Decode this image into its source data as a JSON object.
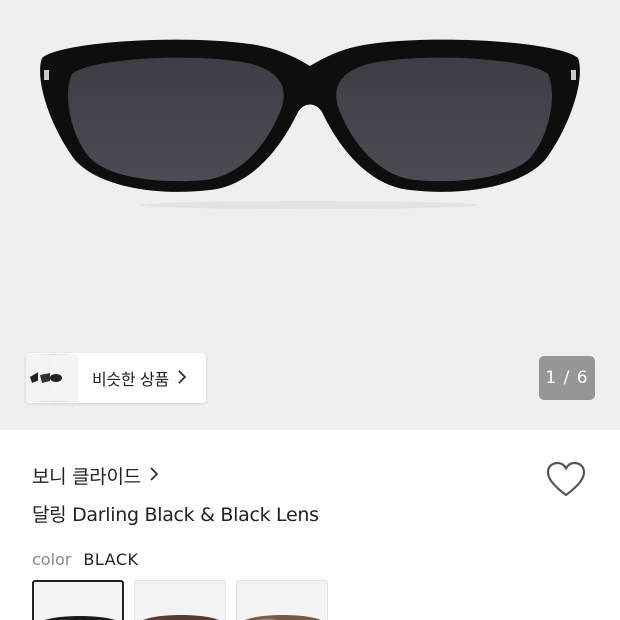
{
  "hero": {
    "similar_label": "비슷한 상품",
    "counter": "1 / 6"
  },
  "product": {
    "brand": "보니 클라이드",
    "title": "달링 Darling Black & Black Lens",
    "color_label": "color",
    "color_value": "BLACK"
  },
  "swatches": [
    {
      "name": "black",
      "frame_color": "#1a1a1a"
    },
    {
      "name": "brown",
      "frame_color": "#5a3a2a"
    },
    {
      "name": "tortoise",
      "frame_color": "#7a5a45"
    }
  ],
  "colors": {
    "hero_bg": "#efefef",
    "counter_bg": "#7f7f7f",
    "text": "#222222",
    "muted": "#888888"
  }
}
